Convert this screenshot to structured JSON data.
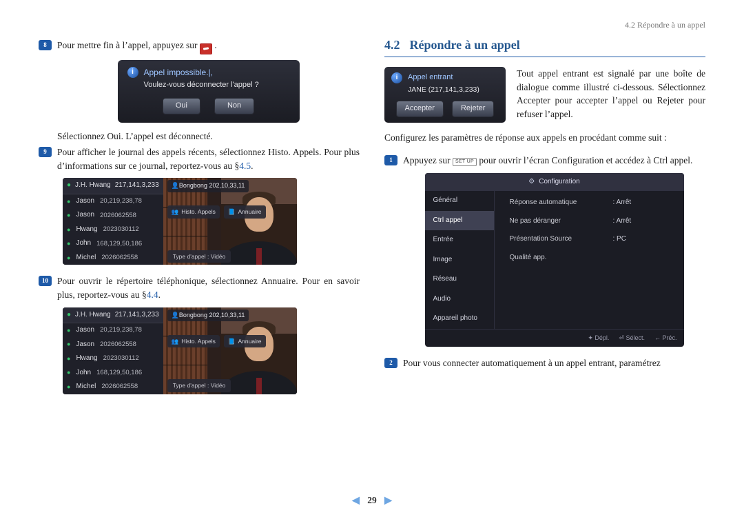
{
  "header": {
    "breadcrumb": "4.2 Répondre à un appel"
  },
  "left": {
    "s8": {
      "num": "8",
      "line1_a": "Pour mettre fin à l’appel, appuyez sur ",
      "line1_b": ".",
      "dlg": {
        "title": "Appel impossible.|,",
        "sub": "Voulez-vous déconnecter l'appel ?",
        "yes": "Oui",
        "no": "Non"
      },
      "line2": "Sélectionnez Oui. L’appel est déconnecté."
    },
    "s9": {
      "num": "9",
      "text_a": "Pour afficher le journal des appels récents, sélectionnez Histo. Appels. Pour plus d’informations sur ce journal, reportez-vous au §",
      "ref": "4.5",
      "text_b": "."
    },
    "s10": {
      "num": "10",
      "text_a": "Pour ouvrir le répertoire téléphonique, sélectionnez Annuaire. Pour en savoir plus, reportez-vous au §",
      "ref": "4.4",
      "text_b": "."
    },
    "callscreen": {
      "header_name": "J.H. Hwang",
      "header_ip": "217,141,3,233",
      "rows": [
        {
          "name": "Jason",
          "ip": "20,219,238,78"
        },
        {
          "name": "Jason",
          "ip": "2026062558"
        },
        {
          "name": "Hwang",
          "ip": "2023030112"
        },
        {
          "name": "John",
          "ip": "168,129,50,186"
        },
        {
          "name": "Michel",
          "ip": "2026062558"
        }
      ],
      "caller": "Bongbong   202,10,33,11",
      "tool_histo": "Histo. Appels",
      "tool_ann": "Annuaire",
      "type_label": "Type d'appel :",
      "type_value": "Vidéo"
    }
  },
  "right": {
    "sec_num": "4.2",
    "sec_title": "Répondre à un appel",
    "intro_text": "Tout appel entrant est signalé par une boîte de dialogue comme illustré ci-dessous. Sélectionnez Accepter pour accepter l’appel ou Rejeter pour refuser l’appel.",
    "incoming": {
      "title": "Appel entrant",
      "caller": "JANE (217,141,3,233)",
      "accept": "Accepter",
      "reject": "Rejeter"
    },
    "config_intro": "Configurez les paramètres de réponse aux appels en procédant comme suit :",
    "s1": {
      "num": "1",
      "a": "Appuyez sur ",
      "setup": "SET UP",
      "b": " pour ouvrir l’écran Configuration et accédez à Ctrl appel."
    },
    "cfg": {
      "title": "Configuration",
      "menu": [
        "Général",
        "Ctrl appel",
        "Entrée",
        "Image",
        "Réseau",
        "Audio",
        "Appareil photo"
      ],
      "active_index": 1,
      "rows": [
        {
          "k": "Réponse automatique",
          "v": ": Arrêt"
        },
        {
          "k": "Ne pas déranger",
          "v": ": Arrêt"
        },
        {
          "k": "Présentation Source",
          "v": ": PC"
        },
        {
          "k": "Qualité app.",
          "v": ""
        }
      ],
      "foot": [
        "✦ Dépl.",
        "⏎ Sélect.",
        "← Préc."
      ]
    },
    "s2": {
      "num": "2",
      "text": "Pour vous connecter automatiquement à un appel entrant, paramétrez"
    }
  },
  "pager": {
    "page": "29"
  }
}
